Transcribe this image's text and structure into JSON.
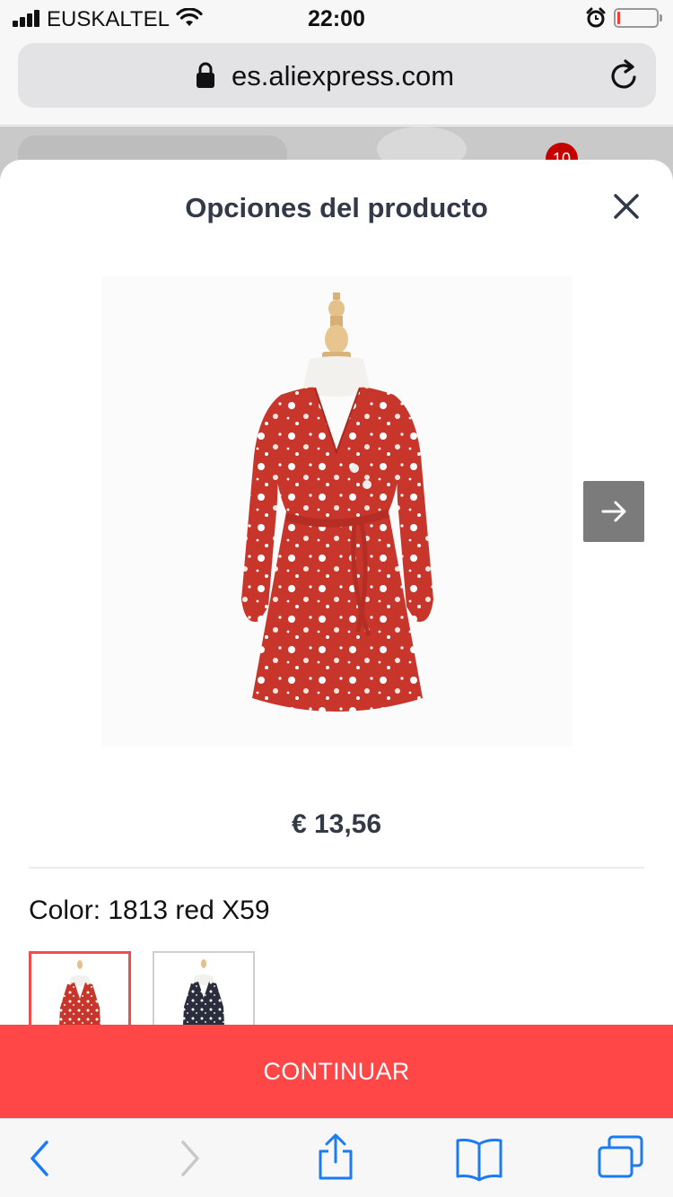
{
  "status_bar": {
    "carrier": "EUSKALTEL",
    "time": "22:00",
    "battery_level": 0.08
  },
  "browser": {
    "url": "es.aliexpress.com"
  },
  "background": {
    "cart_badge": "10"
  },
  "sheet": {
    "title": "Opciones del producto",
    "price": "€ 13,56",
    "color_label": "Color: 1813 red X59",
    "variants": [
      {
        "name": "red floral dress",
        "color": "#c8352a",
        "selected": true
      },
      {
        "name": "black floral dress",
        "color": "#2a2e3c",
        "selected": false
      }
    ],
    "continue_label": "CONTINUAR"
  },
  "colors": {
    "accent": "#ff4747",
    "ios_blue": "#1a7bf2",
    "title_text": "#333a47"
  }
}
